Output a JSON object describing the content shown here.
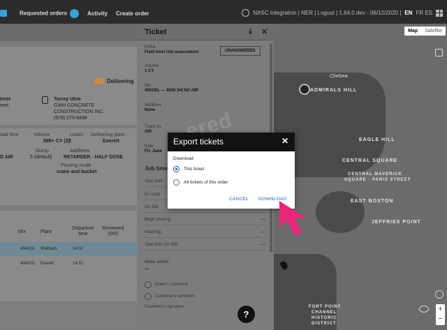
{
  "topbar": {
    "nav": [
      "Requested orders",
      "Activity",
      "Create order"
    ],
    "user_text": "NASC Integration | NER | Logout | 1.64.0.dev - 06/12/2020 | ",
    "lang_active": "EN",
    "lang_other": "FR ES"
  },
  "order": {
    "status": "Delivering",
    "address_line1": "treet",
    "address_line2": "reet",
    "customer_name": "Torrey Utne",
    "company_line1": "GWH CONCRETE",
    "company_line2": "CONSTRUCTION INC.",
    "phone": "(978) 270-9498",
    "stats": {
      "load_time_label": "oad time",
      "volume_label": "Volume",
      "volume_value": "888+ CY (2)",
      "loads_label": "Loads",
      "loads_value": "2",
      "plant_label": "Delivering plant",
      "plant_value": "Everett",
      "mix_prefix": "D AIR",
      "slump_label": "Slump",
      "slump_value": "5 (default)",
      "additives_label": "Additives",
      "additives_value": "RETARDER - HALF DOSE",
      "pouring_label": "Pouring mode",
      "pouring_value": "crane and bucket"
    },
    "table": {
      "headers": [
        "Mix",
        "Plant",
        "Departure time",
        "Reviewed (0/0)"
      ],
      "rows": [
        {
          "mix": "404103.",
          "plant": "Waltham",
          "time": "14:02"
        },
        {
          "mix": "404103.",
          "plant": "Everett",
          "time": "14:31"
        }
      ]
    }
  },
  "ticket": {
    "title": "Ticket",
    "flra_label": "FLRA",
    "flra_value": "Field level risk assessment",
    "flra_status": "UNANSWERED",
    "volume_label": "Volume",
    "volume_value": "1 CY",
    "mix_label": "Mix",
    "mix_value": "404103. — 4000 3/4 NO AIR",
    "additives_label": "Additives",
    "additives_value": "None",
    "truck_label": "Truck no.",
    "truck_value": "200",
    "date_label": "Date",
    "date_value": "Fri, June",
    "job_time": "Job time",
    "rows": [
      "Start load",
      "En route",
      "On Site",
      "Begin pouring",
      "Washing",
      "Total time On Site"
    ],
    "dash": "—",
    "water_label": "Water added",
    "water_value": "—",
    "driver_comment": "Driver's comment",
    "customer_comment": "Customer's comment",
    "customer_signature": "Customer's signature",
    "watermark": "ered",
    "help": "?"
  },
  "modal": {
    "title": "Export tickets",
    "close": "✕",
    "subtitle": "Download",
    "options": [
      "This ticket",
      "All tickets of this order"
    ],
    "selected": 0,
    "cancel": "CANCEL",
    "download": "DOWNLOAD"
  },
  "map": {
    "tabs": [
      "Map",
      "Satellite"
    ],
    "labels": [
      "ADMIRALS HILL",
      "EAGLE HILL",
      "CENTRAL SQUARE",
      "CENTRAL MAVERICK",
      "SQUARE - PARIS STREET",
      "EAST BOSTON",
      "JEFFRIES POINT",
      "Chelsea",
      "FORT POINT",
      "CHANNEL",
      "HISTORIC",
      "DISTRICT"
    ]
  },
  "colors": {
    "modal_accent": "#1a4fa0",
    "cursor": "#e8267a"
  }
}
